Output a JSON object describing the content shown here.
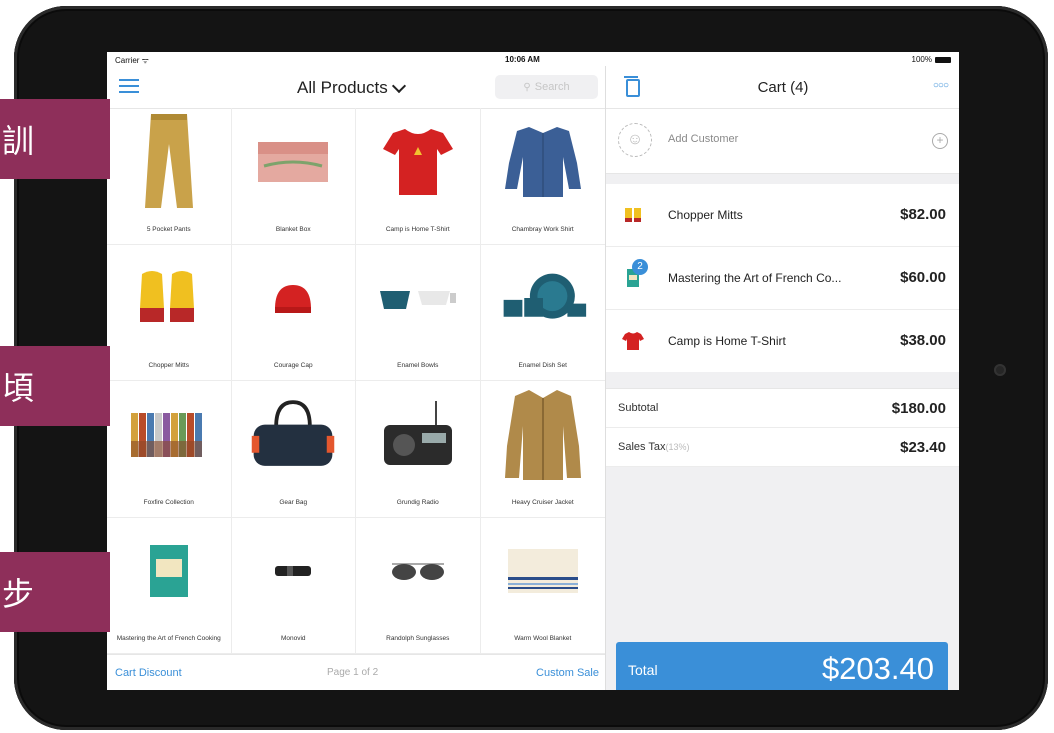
{
  "side_tabs": [
    "訓",
    "頃",
    "步"
  ],
  "status": {
    "carrier": "Carrier ᯤ",
    "time": "10:06 AM",
    "battery": "100%"
  },
  "products_nav": {
    "title": "All Products",
    "search_placeholder": "Search"
  },
  "products": [
    {
      "label": "5 Pocket Pants",
      "icon": "pants"
    },
    {
      "label": "Blanket Box",
      "icon": "box"
    },
    {
      "label": "Camp is Home T-Shirt",
      "icon": "tshirt"
    },
    {
      "label": "Chambray Work Shirt",
      "icon": "shirt"
    },
    {
      "label": "Chopper Mitts",
      "icon": "mitts"
    },
    {
      "label": "Courage Cap",
      "icon": "cap"
    },
    {
      "label": "Enamel Bowls",
      "icon": "bowls"
    },
    {
      "label": "Enamel Dish Set",
      "icon": "dishes"
    },
    {
      "label": "Foxfire Collection",
      "icon": "books"
    },
    {
      "label": "Gear Bag",
      "icon": "bag"
    },
    {
      "label": "Grundig Radio",
      "icon": "radio"
    },
    {
      "label": "Heavy Cruiser Jacket",
      "icon": "jacket"
    },
    {
      "label": "Mastering the Art of French Cooking",
      "icon": "book"
    },
    {
      "label": "Monovid",
      "icon": "monocular"
    },
    {
      "label": "Randolph Sunglasses",
      "icon": "sunglasses"
    },
    {
      "label": "Warm Wool Blanket",
      "icon": "blanket"
    }
  ],
  "footer": {
    "cart_discount": "Cart Discount",
    "page": "Page 1 of 2",
    "custom_sale": "Custom Sale"
  },
  "cart": {
    "title": "Cart (4)",
    "add_customer": "Add Customer",
    "items": [
      {
        "name": "Chopper Mitts",
        "price": "$82.00",
        "qty": ""
      },
      {
        "name": "Mastering the Art of French Co...",
        "price": "$60.00",
        "qty": "2"
      },
      {
        "name": "Camp is Home T-Shirt",
        "price": "$38.00",
        "qty": ""
      }
    ],
    "subtotal_label": "Subtotal",
    "subtotal": "$180.00",
    "tax_label": "Sales Tax",
    "tax_rate": "(13%)",
    "tax": "$23.40",
    "total_label": "Total",
    "total": "$203.40"
  },
  "colors": {
    "accent": "#3a8fd8",
    "tab": "#8e2f5a"
  }
}
